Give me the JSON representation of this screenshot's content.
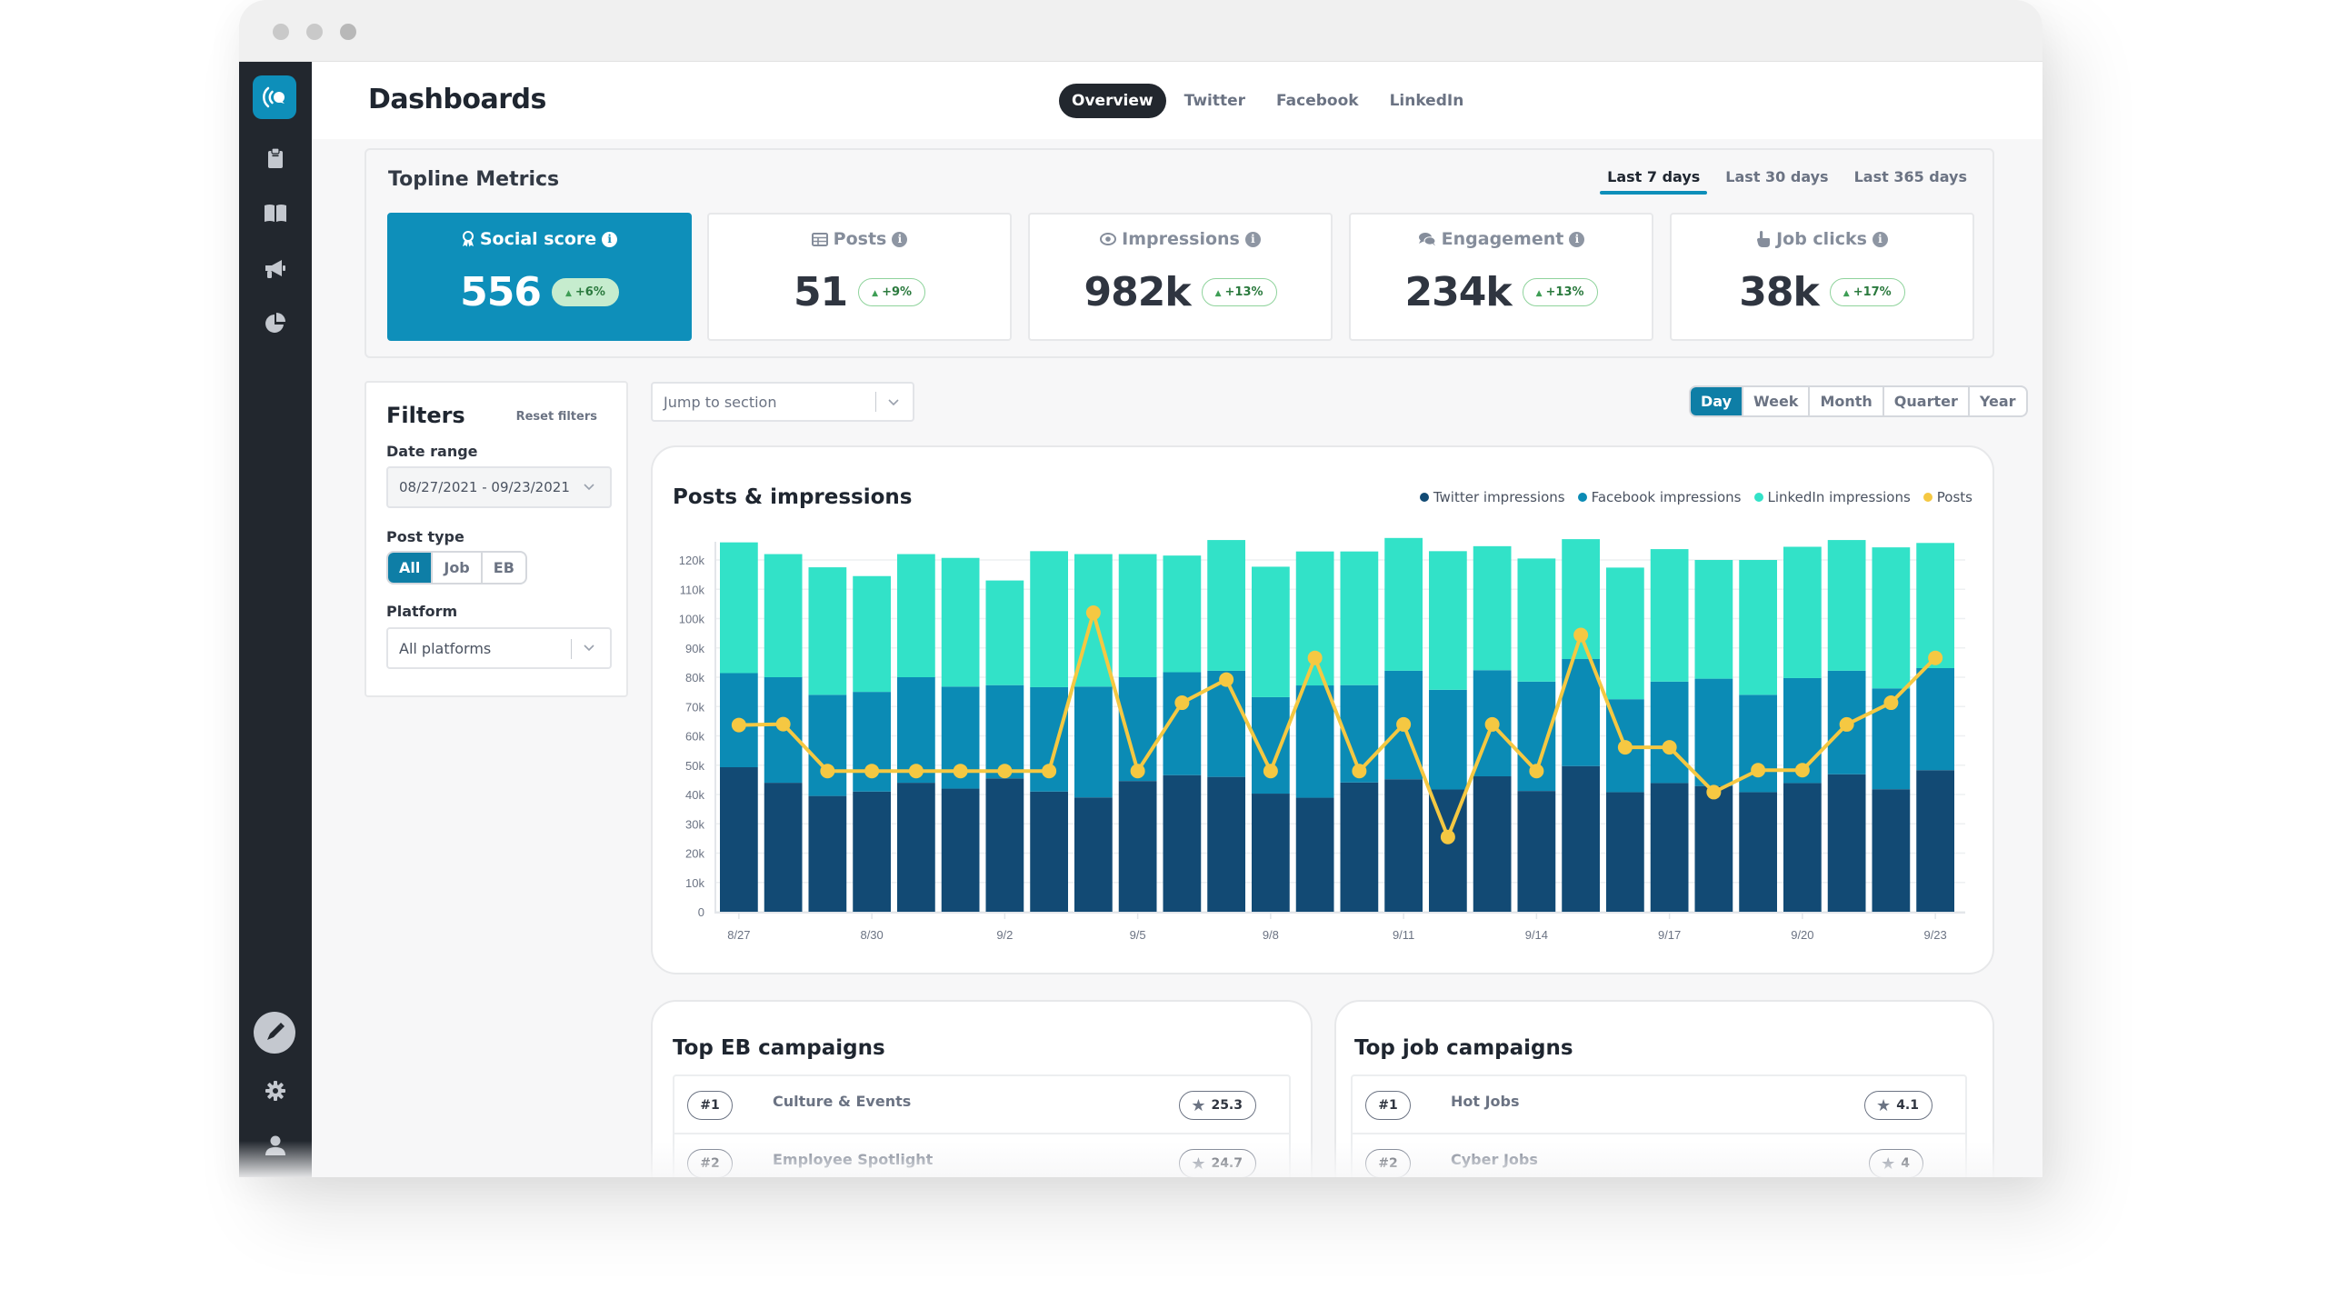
{
  "app": {
    "title": "Dashboards",
    "tabs": [
      {
        "label": "Overview",
        "active": true
      },
      {
        "label": "Twitter",
        "active": false
      },
      {
        "label": "Facebook",
        "active": false
      },
      {
        "label": "LinkedIn",
        "active": false
      }
    ]
  },
  "sidebar": {
    "logo": "broadcast-logo",
    "items": [
      {
        "icon": "clipboard-icon"
      },
      {
        "icon": "book-icon"
      },
      {
        "icon": "megaphone-icon"
      },
      {
        "icon": "pie-chart-icon"
      }
    ],
    "bottom_items": [
      {
        "icon": "pen-icon"
      },
      {
        "icon": "gear-icon"
      },
      {
        "icon": "user-icon"
      }
    ]
  },
  "topline": {
    "title": "Topline Metrics",
    "ranges": [
      {
        "label": "Last 7 days",
        "active": true
      },
      {
        "label": "Last 30 days",
        "active": false
      },
      {
        "label": "Last 365 days",
        "active": false
      }
    ],
    "cards": [
      {
        "label": "Social score",
        "icon": "award-icon",
        "value": "556",
        "delta": "+6%",
        "primary": true
      },
      {
        "label": "Posts",
        "icon": "table-icon",
        "value": "51",
        "delta": "+9%",
        "primary": false
      },
      {
        "label": "Impressions",
        "icon": "eye-icon",
        "value": "982k",
        "delta": "+13%",
        "primary": false
      },
      {
        "label": "Engagement",
        "icon": "comments-icon",
        "value": "234k",
        "delta": "+13%",
        "primary": false
      },
      {
        "label": "Job clicks",
        "icon": "pointer-hand-icon",
        "value": "38k",
        "delta": "+17%",
        "primary": false
      }
    ]
  },
  "filters": {
    "title": "Filters",
    "reset_label": "Reset filters",
    "date_range_label": "Date range",
    "date_range_value": "08/27/2021 - 09/23/2021",
    "post_type_label": "Post type",
    "post_types": [
      {
        "label": "All",
        "active": true
      },
      {
        "label": "Job",
        "active": false
      },
      {
        "label": "EB",
        "active": false
      }
    ],
    "platform_label": "Platform",
    "platform_value": "All platforms"
  },
  "jump": {
    "placeholder": "Jump to section"
  },
  "period": [
    {
      "label": "Day",
      "active": true
    },
    {
      "label": "Week",
      "active": false
    },
    {
      "label": "Month",
      "active": false
    },
    {
      "label": "Quarter",
      "active": false
    },
    {
      "label": "Year",
      "active": false
    }
  ],
  "colors": {
    "accent": "#0e8fba",
    "twitter": "#124a74",
    "facebook": "#0b8bb5",
    "linkedin": "#32e2c8",
    "posts": "#f5c842"
  },
  "chart_data": {
    "type": "bar",
    "title": "Posts & impressions",
    "stacked": true,
    "xlabel": "",
    "ylabel": "",
    "ylim": [
      0,
      120000
    ],
    "yticks": [
      0,
      10000,
      20000,
      30000,
      40000,
      50000,
      60000,
      70000,
      80000,
      90000,
      100000,
      110000,
      120000
    ],
    "ytick_labels": [
      "0",
      "10k",
      "20k",
      "30k",
      "40k",
      "50k",
      "60k",
      "70k",
      "80k",
      "90k",
      "100k",
      "110k",
      "120k"
    ],
    "grid": true,
    "legend_position": "top-right",
    "categories": [
      "8/27",
      "8/28",
      "8/29",
      "8/30",
      "8/31",
      "9/1",
      "9/2",
      "9/3",
      "9/4",
      "9/5",
      "9/6",
      "9/7",
      "9/8",
      "9/9",
      "9/10",
      "9/11",
      "9/12",
      "9/13",
      "9/14",
      "9/15",
      "9/16",
      "9/17",
      "9/18",
      "9/19",
      "9/20",
      "9/21",
      "9/22",
      "9/23"
    ],
    "xtick_labels": [
      "8/27",
      "8/30",
      "9/2",
      "9/5",
      "9/8",
      "9/11",
      "9/14",
      "9/17",
      "9/20",
      "9/23"
    ],
    "series": [
      {
        "name": "Twitter impressions",
        "type": "bar",
        "values": [
          49300,
          44000,
          39500,
          41000,
          44000,
          42000,
          45500,
          41000,
          39000,
          44600,
          46600,
          46000,
          40300,
          38900,
          44100,
          45200,
          41700,
          46200,
          41200,
          49700,
          40800,
          43900,
          42900,
          40800,
          43900,
          46900,
          41800,
          48300
        ]
      },
      {
        "name": "Facebook impressions",
        "type": "bar",
        "values": [
          32100,
          36000,
          34500,
          34000,
          36000,
          34800,
          31800,
          35600,
          37800,
          35400,
          35100,
          36200,
          32900,
          38300,
          33200,
          37000,
          34000,
          36200,
          37300,
          36500,
          31700,
          34600,
          36600,
          33200,
          35800,
          35300,
          34400,
          34800
        ]
      },
      {
        "name": "LinkedIn impressions",
        "type": "bar",
        "values": [
          44600,
          42000,
          43500,
          39500,
          42000,
          43900,
          35700,
          46400,
          45200,
          42000,
          39800,
          44600,
          44500,
          45700,
          45600,
          45300,
          47300,
          42300,
          42000,
          40900,
          44900,
          45200,
          40500,
          46000,
          44800,
          44600,
          48100,
          42700
        ]
      },
      {
        "name": "Posts",
        "type": "line",
        "values": [
          63700,
          64000,
          48000,
          48000,
          48000,
          48000,
          48000,
          48000,
          102000,
          48000,
          71300,
          79200,
          48000,
          86600,
          48000,
          63900,
          25500,
          63900,
          48000,
          94400,
          56100,
          56100,
          40800,
          48300,
          48300,
          63900,
          71300,
          86600
        ]
      }
    ]
  },
  "campaigns": {
    "eb": {
      "title": "Top EB campaigns",
      "rows": [
        {
          "rank": "#1",
          "name": "Culture & Events",
          "score": "25.3"
        },
        {
          "rank": "#2",
          "name": "Employee Spotlight",
          "score": "24.7"
        }
      ]
    },
    "job": {
      "title": "Top job campaigns",
      "rows": [
        {
          "rank": "#1",
          "name": "Hot Jobs",
          "score": "4.1"
        },
        {
          "rank": "#2",
          "name": "Cyber Jobs",
          "score": "4"
        }
      ]
    }
  }
}
